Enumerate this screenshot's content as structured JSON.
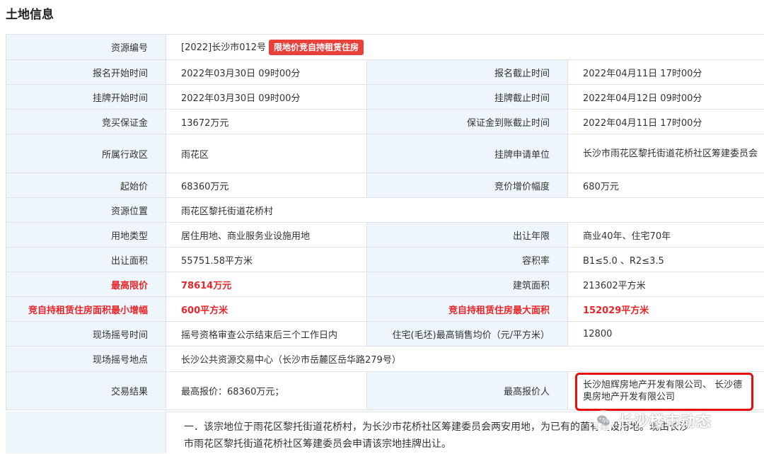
{
  "page_title": "土地信息",
  "rows": {
    "resource_no": {
      "label": "资源编号",
      "value": "[2022]长沙市012号",
      "badge": "限地价竞自持租赁住房"
    },
    "reg_start": {
      "label": "报名开始时间",
      "value": "2022年03月30日 09时00分"
    },
    "reg_end": {
      "label": "报名截止时间",
      "value": "2022年04月11日 17时00分"
    },
    "list_start": {
      "label": "挂牌开始时间",
      "value": "2022年03月30日 09时00分"
    },
    "list_end": {
      "label": "挂牌截止时间",
      "value": "2022年04月12日 09时00分"
    },
    "deposit": {
      "label": "竞买保证金",
      "value": "13672万元"
    },
    "deposit_deadline": {
      "label": "保证金到账截止时间",
      "value": "2022年04月11日 17时00分"
    },
    "district": {
      "label": "所属行政区",
      "value": "雨花区"
    },
    "applicant": {
      "label": "挂牌申请单位",
      "value": "长沙市雨花区黎托街道花桥社区筹建委员会"
    },
    "start_price": {
      "label": "起始价",
      "value": "68360万元"
    },
    "increment": {
      "label": "竞价增价幅度",
      "value": "680万元"
    },
    "location": {
      "label": "资源位置",
      "value": "雨花区黎托街道花桥村"
    },
    "land_use": {
      "label": "用地类型",
      "value": "居住用地、商业服务业设施用地"
    },
    "term": {
      "label": "出让年限",
      "value": "商业40年、住宅70年"
    },
    "area": {
      "label": "出让面积",
      "value": "55751.58平方米"
    },
    "far": {
      "label": "容积率",
      "value": "B1≤5.0 、R2≤3.5"
    },
    "max_price": {
      "label": "最高限价",
      "value": "78614万元"
    },
    "building_area": {
      "label": "建筑面积",
      "value": "213602平方米"
    },
    "min_increment": {
      "label": "竞自持租赁住房面积最小增幅",
      "value": "600平方米"
    },
    "max_rental": {
      "label": "竞自持租赁住房最大面积",
      "value": "152029平方米"
    },
    "lottery_time": {
      "label": "现场摇号时间",
      "value": "摇号资格审查公示结束后三个工作日内"
    },
    "avg_price": {
      "label": "住宅(毛坯)最高销售均价（元/平方米）",
      "value": "12800"
    },
    "lottery_place": {
      "label": "现场摇号地点",
      "value": "长沙公共资源交易中心（长沙市岳麓区岳华路279号）"
    },
    "result": {
      "label": "交易结果",
      "value": "最高报价：68360万元；"
    },
    "bidder": {
      "label": "最高报价人",
      "value": "长沙旭辉房地产开发有限公司、 长沙德奥房地产开发有限公司"
    }
  },
  "notes": {
    "line1": "一．该宗地位于雨花区黎托街道花桥村，为长沙市花桥社区筹建委员会两安用地，为已有的菌有建设用地。现由长沙",
    "line2": "市雨花区黎托街道花桥社区筹建委员会申请该宗地挂牌出让。"
  },
  "watermark": {
    "text": "长沙楼市动态",
    "icon": "wechat-icon"
  },
  "colors": {
    "label_bg": "#eef6fb",
    "border": "#dde3e8",
    "accent_red": "#e8262a",
    "badge_bg": "#e8413c",
    "highlight_box": "#e60f0f"
  }
}
